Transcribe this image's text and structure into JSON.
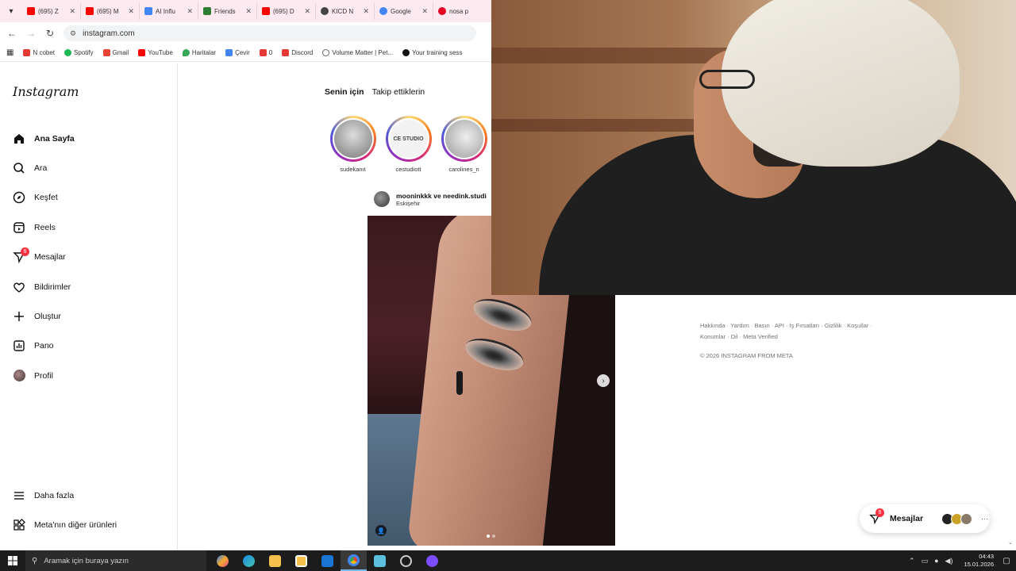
{
  "browser": {
    "tabs": [
      {
        "label": "(695) Z",
        "color": "#ff0000"
      },
      {
        "label": "(695) M",
        "color": "#ff0000"
      },
      {
        "label": "AI Influ",
        "color": "#4285f4"
      },
      {
        "label": "Friends",
        "color": "#2e7d32"
      },
      {
        "label": "(695) D",
        "color": "#ff0000"
      },
      {
        "label": "KICD N",
        "color": "#444444"
      },
      {
        "label": "Google",
        "color": "#4285f4"
      },
      {
        "label": "nosa p",
        "color": "#e60023"
      }
    ],
    "url": "instagram.com",
    "bookmarks": [
      {
        "label": "N cobet",
        "color": "#e53935"
      },
      {
        "label": "Spotify",
        "color": "#1db954"
      },
      {
        "label": "Gmail",
        "color": "#ea4335"
      },
      {
        "label": "YouTube",
        "color": "#ff0000"
      },
      {
        "label": "Haritalar",
        "color": "#34a853"
      },
      {
        "label": "Çevir",
        "color": "#4285f4"
      },
      {
        "label": "0",
        "color": "#e53935"
      },
      {
        "label": "Discord",
        "color": "#e53935"
      },
      {
        "label": "Volume Matter | Pet...",
        "color": "#666666"
      },
      {
        "label": "Your training sess",
        "color": "#111111"
      }
    ]
  },
  "sidebar": {
    "logo": "Instagram",
    "items": [
      {
        "label": "Ana Sayfa",
        "icon": "home-icon"
      },
      {
        "label": "Ara",
        "icon": "search-icon"
      },
      {
        "label": "Keşfet",
        "icon": "compass-icon"
      },
      {
        "label": "Reels",
        "icon": "reels-icon"
      },
      {
        "label": "Mesajlar",
        "icon": "messenger-icon",
        "badge": "6"
      },
      {
        "label": "Bildirimler",
        "icon": "heart-icon"
      },
      {
        "label": "Oluştur",
        "icon": "plus-icon"
      },
      {
        "label": "Pano",
        "icon": "dashboard-icon"
      },
      {
        "label": "Profil",
        "icon": "avatar"
      }
    ],
    "bottom": [
      {
        "label": "Daha fazla",
        "icon": "menu-icon"
      },
      {
        "label": "Meta'nın diğer ürünleri",
        "icon": "grid-icon"
      }
    ]
  },
  "feed": {
    "tabs": [
      "Senin için",
      "Takip ettiklerin"
    ],
    "stories": [
      {
        "user": "sudekanıt",
        "color": "#9e9e9e"
      },
      {
        "user": "cestudiott",
        "label": "CE STUDIO",
        "color": "#eeeeee"
      },
      {
        "user": "carolines_n",
        "color": "#bdbdbd"
      }
    ],
    "post": {
      "author": "mooninkkk ve needink.studi",
      "location": "Eskişehir"
    }
  },
  "footer": {
    "links": "Hakkında · Yardım · Basın · API · İş Fırsatları · Gizlilik · Koşullar · Konumlar · Dil · Meta Verified",
    "copyright": "© 2026 INSTAGRAM FROM META"
  },
  "messages_pill": {
    "label": "Mesajlar",
    "badge": "6"
  },
  "taskbar": {
    "search_placeholder": "Aramak için buraya yazın",
    "time": "04:43",
    "date": "15.01.2026"
  }
}
